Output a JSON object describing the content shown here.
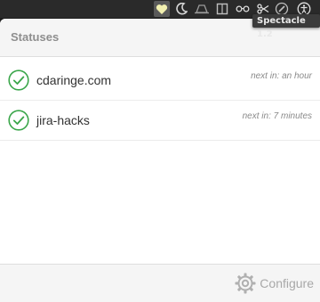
{
  "menubar": {
    "tooltip": "Spectacle 1.2",
    "icons": [
      "heart-icon",
      "moon-icon",
      "alfred-hat-icon",
      "book-icon",
      "glasses-icon",
      "scissors-icon",
      "wrench-icon",
      "accessibility-icon"
    ]
  },
  "popover": {
    "title": "Statuses",
    "statuses": [
      {
        "name": "cdaringe.com",
        "next": "next in: an hour",
        "state": "ok"
      },
      {
        "name": "jira-hacks",
        "next": "next in: 7 minutes",
        "state": "ok"
      }
    ],
    "configure_label": "Configure"
  },
  "colors": {
    "success_green": "#3aa64a",
    "header_bg": "#f5f5f5",
    "muted_text": "#8e8e8e"
  }
}
